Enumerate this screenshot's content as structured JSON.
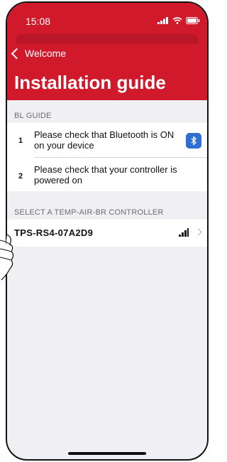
{
  "status_bar": {
    "time": "15:08"
  },
  "nav": {
    "back_label": "Welcome"
  },
  "page": {
    "title": "Installation guide"
  },
  "guide": {
    "section_header": "BL GUIDE",
    "steps": [
      {
        "number": "1",
        "text": "Please check that Bluetooth is ON on your device",
        "icon": "bluetooth-icon"
      },
      {
        "number": "2",
        "text": "Please check that your controller is powered on"
      }
    ]
  },
  "controllers": {
    "section_header": "SELECT A TEMP-AIR-BR CONTROLLER",
    "items": [
      {
        "name": "TPS-RS4-07A2D9",
        "signal_bars": 3,
        "signal_max": 4
      }
    ]
  },
  "colors": {
    "brand_red": "#d0192b",
    "bluetooth_blue": "#2f6fd0",
    "background": "#f0eff4"
  }
}
